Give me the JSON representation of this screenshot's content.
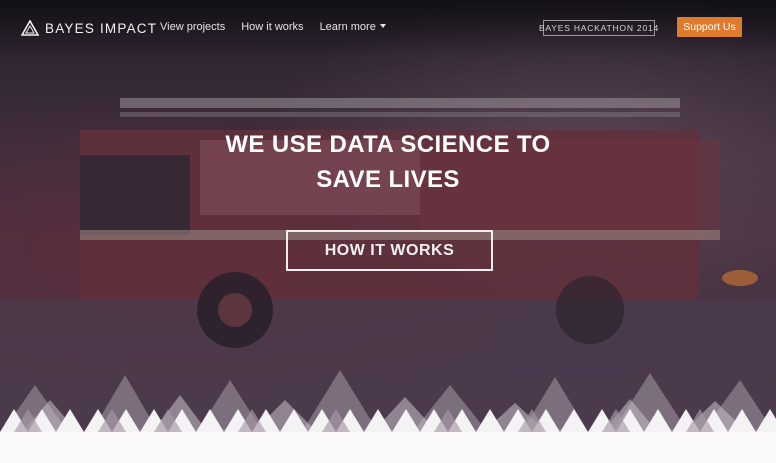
{
  "brand": {
    "name": "BAYES IMPACT",
    "logo_icon": "triangle-logo-icon"
  },
  "nav": {
    "items": [
      {
        "label": "View projects"
      },
      {
        "label": "How it works"
      },
      {
        "label": "Learn more",
        "has_dropdown": true
      }
    ]
  },
  "hackathon_badge": "BAYES HACKATHON 2014",
  "support_button": {
    "label": "Support Us",
    "color": "#e07b2b"
  },
  "hero": {
    "headline_line1": "WE USE DATA SCIENCE TO",
    "headline_line2": "SAVE LIVES",
    "cta_label": "HOW IT WORKS",
    "background": "fire-truck-photo"
  }
}
